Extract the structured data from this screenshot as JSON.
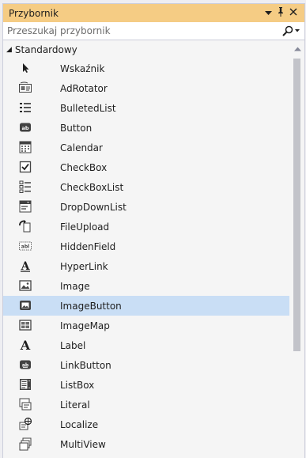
{
  "panel": {
    "title": "Przybornik",
    "dropdown_icon": "triangle-down",
    "pin_icon": "pin",
    "close_icon": "close"
  },
  "search": {
    "placeholder": "Przeszukaj przybornik",
    "icon": "magnifier"
  },
  "group": {
    "label": "Standardowy",
    "expanded": true,
    "items": [
      {
        "label": "Wskaźnik",
        "icon": "pointer-arrow"
      },
      {
        "label": "AdRotator",
        "icon": "adrotator"
      },
      {
        "label": "BulletedList",
        "icon": "bulleted-list"
      },
      {
        "label": "Button",
        "icon": "button-ab"
      },
      {
        "label": "Calendar",
        "icon": "calendar"
      },
      {
        "label": "CheckBox",
        "icon": "checkbox"
      },
      {
        "label": "CheckBoxList",
        "icon": "checkbox-list"
      },
      {
        "label": "DropDownList",
        "icon": "dropdown-list"
      },
      {
        "label": "FileUpload",
        "icon": "file-upload"
      },
      {
        "label": "HiddenField",
        "icon": "hidden-field"
      },
      {
        "label": "HyperLink",
        "icon": "hyperlink-a"
      },
      {
        "label": "Image",
        "icon": "image"
      },
      {
        "label": "ImageButton",
        "icon": "image-button",
        "selected": true
      },
      {
        "label": "ImageMap",
        "icon": "image-map"
      },
      {
        "label": "Label",
        "icon": "label-a"
      },
      {
        "label": "LinkButton",
        "icon": "link-button"
      },
      {
        "label": "ListBox",
        "icon": "list-box"
      },
      {
        "label": "Literal",
        "icon": "literal"
      },
      {
        "label": "Localize",
        "icon": "localize"
      },
      {
        "label": "MultiView",
        "icon": "multiview"
      }
    ]
  },
  "colors": {
    "title_bg": "#f5cc84",
    "selected_bg": "#c9def5",
    "scroll_thumb": "#c2c3c9"
  }
}
